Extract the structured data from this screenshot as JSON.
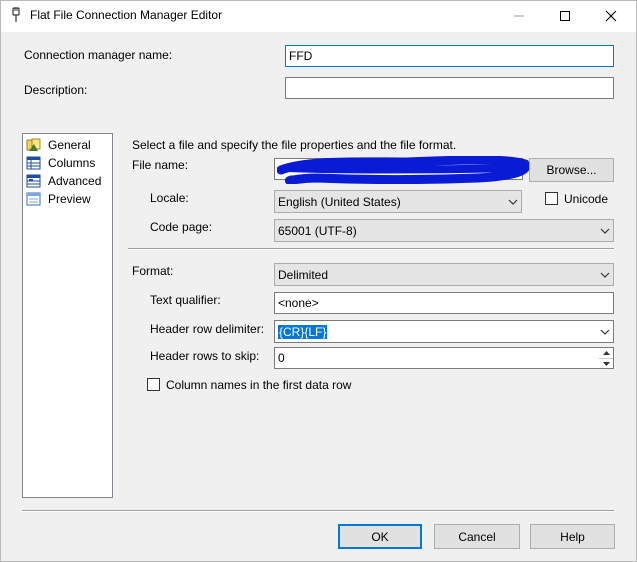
{
  "window": {
    "title": "Flat File Connection Manager Editor",
    "icon": "connection-plug-icon",
    "minimize_glyph": "—",
    "maximize_glyph": "☐",
    "close_glyph": "✕"
  },
  "connection": {
    "name_label": "Connection manager name:",
    "name_value": "FFD",
    "description_label": "Description:",
    "description_value": ""
  },
  "nav": {
    "items": [
      {
        "label": "General",
        "icon": "general-icon"
      },
      {
        "label": "Columns",
        "icon": "columns-icon"
      },
      {
        "label": "Advanced",
        "icon": "advanced-icon"
      },
      {
        "label": "Preview",
        "icon": "preview-icon"
      }
    ]
  },
  "general": {
    "intro": "Select a file and specify the file properties and the file format.",
    "file_name_label": "File name:",
    "file_name_value": "",
    "browse_label": "Browse...",
    "locale_label": "Locale:",
    "locale_value": "English (United States)",
    "unicode_label": "Unicode",
    "unicode_checked": false,
    "code_page_label": "Code page:",
    "code_page_value": "65001 (UTF-8)",
    "format_label": "Format:",
    "format_value": "Delimited",
    "text_qualifier_label": "Text qualifier:",
    "text_qualifier_value": "<none>",
    "header_row_delimiter_label": "Header row delimiter:",
    "header_row_delimiter_value": "{CR}{LF}",
    "header_rows_to_skip_label": "Header rows to skip:",
    "header_rows_to_skip_value": "0",
    "column_names_label": "Column names in the first data row",
    "column_names_checked": false
  },
  "buttons": {
    "ok": "OK",
    "cancel": "Cancel",
    "help": "Help"
  },
  "colors": {
    "accent": "#0078d7",
    "redaction": "#0a1bd6"
  }
}
